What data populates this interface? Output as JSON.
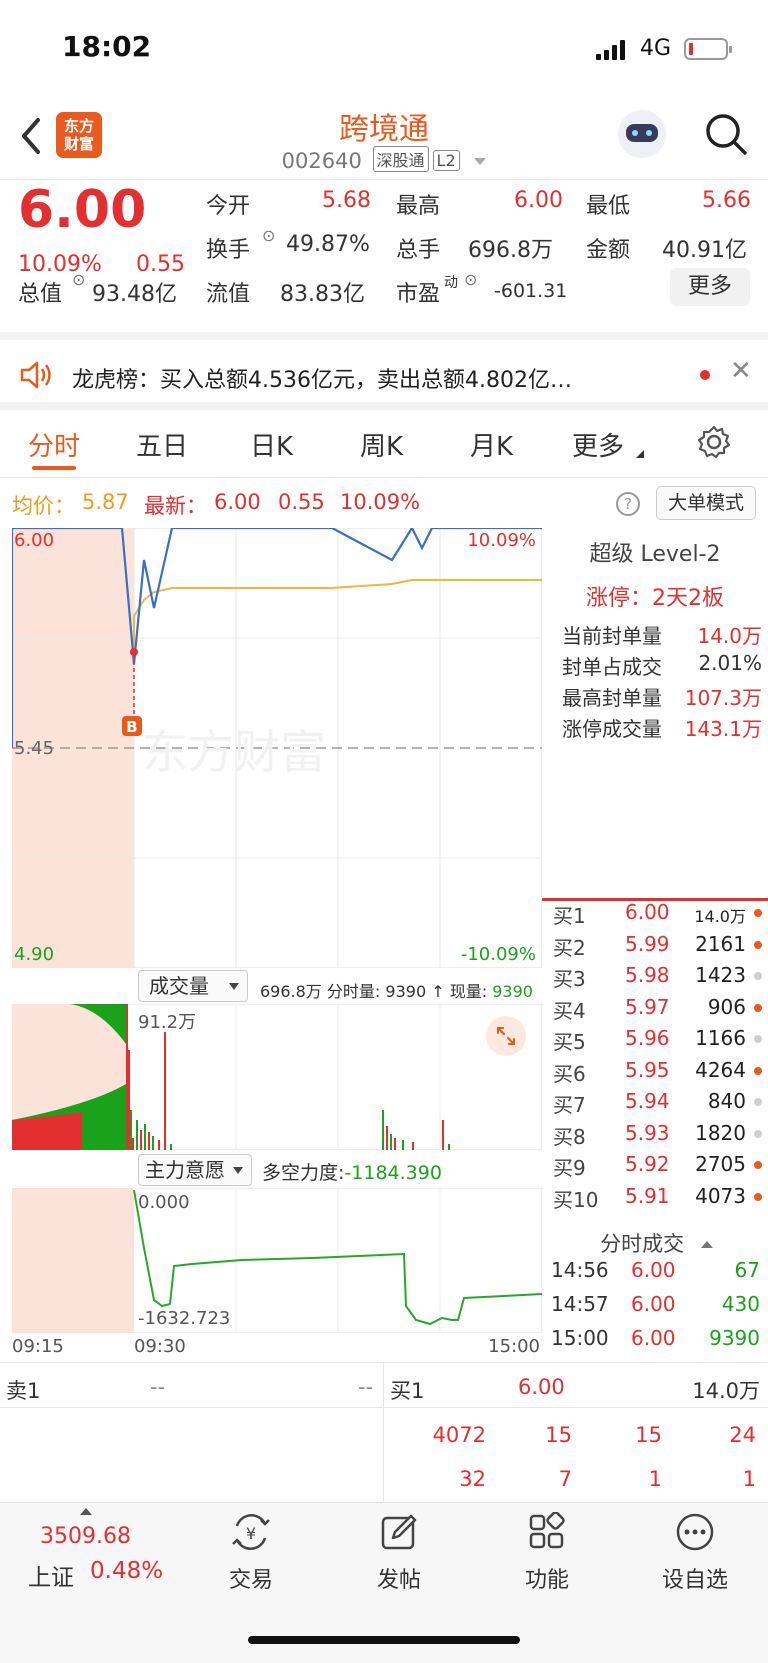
{
  "status_bar": {
    "time": "18:02",
    "network": "4G"
  },
  "header": {
    "back_icon": "chevron-left-icon",
    "logo_text": "东方\n财富",
    "title": "跨境通",
    "code": "002640",
    "tag": "深股通",
    "level_tag": "L2",
    "robot_icon": "robot-avatar-icon",
    "search_icon": "search-icon"
  },
  "quote": {
    "price": "6.00",
    "pct": "10.09%",
    "change": "0.55",
    "open_label": "今开",
    "open": "5.68",
    "high_label": "最高",
    "high": "6.00",
    "low_label": "最低",
    "low": "5.66",
    "turnover_label": "换手",
    "turnover": "49.87%",
    "volume_label": "总手",
    "volume": "696.8万",
    "amount_label": "金额",
    "amount": "40.91亿",
    "mktcap_label": "总值",
    "mktcap": "93.48亿",
    "float_label": "流值",
    "float": "83.83亿",
    "pe_label": "市盈",
    "pe_sup": "动",
    "pe": "-601.31",
    "more_button": "更多"
  },
  "lhb": {
    "text": "龙虎榜：买入总额4.536亿元，卖出总额4.802亿…"
  },
  "tabs": [
    "分时",
    "五日",
    "日K",
    "周K",
    "月K",
    "更多"
  ],
  "info": {
    "avg_label": "均价：",
    "avg": "5.87",
    "latest_label": "最新：",
    "latest": "6.00",
    "change": "0.55",
    "pct": "10.09%",
    "mode_button": "大单模式"
  },
  "chart_labels": {
    "top_price": "6.00",
    "top_pct": "10.09%",
    "mid_price": "5.45",
    "bottom_price": "4.90",
    "bottom_pct": "-10.09%",
    "buy_marker": "B",
    "watermark": "东方财富"
  },
  "chart_data": {
    "type": "line",
    "x_range": [
      "09:15",
      "15:00"
    ],
    "ylim": [
      4.9,
      6.0
    ],
    "prev_close": 5.45,
    "series": [
      {
        "values": [
          6.0,
          6.0,
          5.66,
          5.92,
          5.8,
          6.0,
          6.0,
          6.0,
          6.0,
          5.92,
          6.0,
          5.95,
          6.0,
          6.0,
          6.0
        ]
      },
      {
        "values": [
          5.7,
          5.7,
          5.78,
          5.82,
          5.84,
          5.85,
          5.85,
          5.85,
          5.85,
          5.86,
          5.87,
          5.87,
          5.87,
          5.87,
          5.87
        ]
      }
    ]
  },
  "volume": {
    "selector": "成交量",
    "total": "696.8万",
    "minute_label": "分时量:",
    "minute": "9390",
    "current_label": "现量:",
    "current": "9390",
    "peak_label": "91.2万"
  },
  "flow": {
    "selector": "主力意愿",
    "label": "多空力度:",
    "value": "-1184.390",
    "top_label": "0.000",
    "bottom_label": "-1632.723"
  },
  "time_axis": {
    "start": "09:15",
    "mid": "09:30",
    "end": "15:00"
  },
  "level2": {
    "title": "超级 Level-2",
    "limit_label": "涨停：",
    "limit_value": "2天2板",
    "rows": [
      {
        "label": "当前封单量",
        "value": "14.0万"
      },
      {
        "label": "封单占成交",
        "value": "2.01%"
      },
      {
        "label": "最高封单量",
        "value": "107.3万"
      },
      {
        "label": "涨停成交量",
        "value": "143.1万"
      }
    ]
  },
  "orderbook": [
    {
      "label": "买1",
      "price": "6.00",
      "qty": "14.0万",
      "dot": "#e8591a"
    },
    {
      "label": "买2",
      "price": "5.99",
      "qty": "2161",
      "dot": "#e8591a"
    },
    {
      "label": "买3",
      "price": "5.98",
      "qty": "1423",
      "dot": "#cfcfcf"
    },
    {
      "label": "买4",
      "price": "5.97",
      "qty": "906",
      "dot": "#e8591a"
    },
    {
      "label": "买5",
      "price": "5.96",
      "qty": "1166",
      "dot": "#cfcfcf"
    },
    {
      "label": "买6",
      "price": "5.95",
      "qty": "4264",
      "dot": "#e8591a"
    },
    {
      "label": "买7",
      "price": "5.94",
      "qty": "840",
      "dot": "#cfcfcf"
    },
    {
      "label": "买8",
      "price": "5.93",
      "qty": "1820",
      "dot": "#cfcfcf"
    },
    {
      "label": "买9",
      "price": "5.92",
      "qty": "2705",
      "dot": "#e8591a"
    },
    {
      "label": "买10",
      "price": "5.91",
      "qty": "4073",
      "dot": "#e8591a"
    }
  ],
  "trades": {
    "title": "分时成交",
    "rows": [
      {
        "time": "14:56",
        "price": "6.00",
        "qty": "67"
      },
      {
        "time": "14:57",
        "price": "6.00",
        "qty": "430"
      },
      {
        "time": "15:00",
        "price": "6.00",
        "qty": "9390"
      }
    ]
  },
  "bottom_book": {
    "sell_label": "卖1",
    "sell_price": "--",
    "sell_qty": "--",
    "buy_label": "买1",
    "buy_price": "6.00",
    "buy_qty": "14.0万",
    "row1": [
      "4072",
      "15",
      "15",
      "24"
    ],
    "row2": [
      "32",
      "7",
      "1",
      "1"
    ]
  },
  "tabbar": {
    "index_value": "3509.68",
    "index_name": "上证",
    "index_pct": "0.48%",
    "items": [
      {
        "label": "交易",
        "icon": "trade-yen-icon"
      },
      {
        "label": "发帖",
        "icon": "compose-icon"
      },
      {
        "label": "功能",
        "icon": "grid-icon"
      },
      {
        "label": "设自选",
        "icon": "more-dots-icon"
      }
    ]
  }
}
